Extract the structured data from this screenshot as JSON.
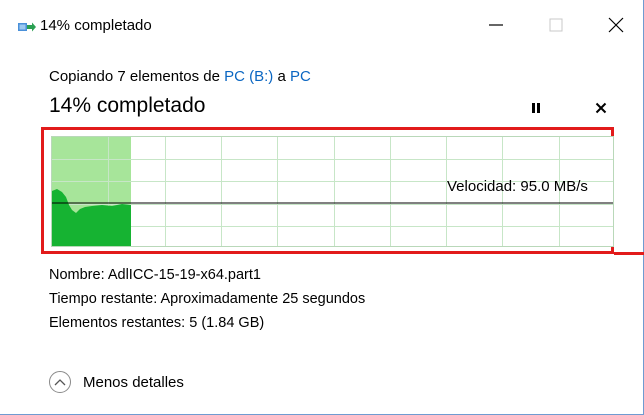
{
  "window": {
    "title": "14% completado"
  },
  "header": {
    "copy_prefix": "Copiando 7 elementos de ",
    "source": "PC (B:)",
    "connector": " a ",
    "destination": "PC",
    "percent_label": "14% completado"
  },
  "progress": {
    "percent": 14,
    "fraction": 0.14
  },
  "graph": {
    "speed_label": "Velocidad: 95.0 MB/s"
  },
  "details": {
    "name_label": "Nombre:",
    "name_value": "AdlICC-15-19-x64.part1",
    "time_label": "Tiempo restante:",
    "time_value": "Aproximadamente 25 segundos",
    "items_label": "Elementos restantes:",
    "items_value": "5 (1.84 GB)"
  },
  "footer": {
    "toggle_label": "Menos detalles"
  },
  "colors": {
    "accent_link": "#0a66c2",
    "graph_fill": "#16b332",
    "graph_progress_bg": "#a7e59a",
    "grid": "#c7e6c7",
    "highlight": "#e21b1b"
  },
  "icons": {
    "app": "file-copy-icon",
    "minimize": "minimize-icon",
    "maximize": "maximize-icon",
    "close": "close-icon",
    "pause": "pause-icon",
    "cancel": "cancel-icon",
    "toggle": "chevron-up-icon"
  }
}
